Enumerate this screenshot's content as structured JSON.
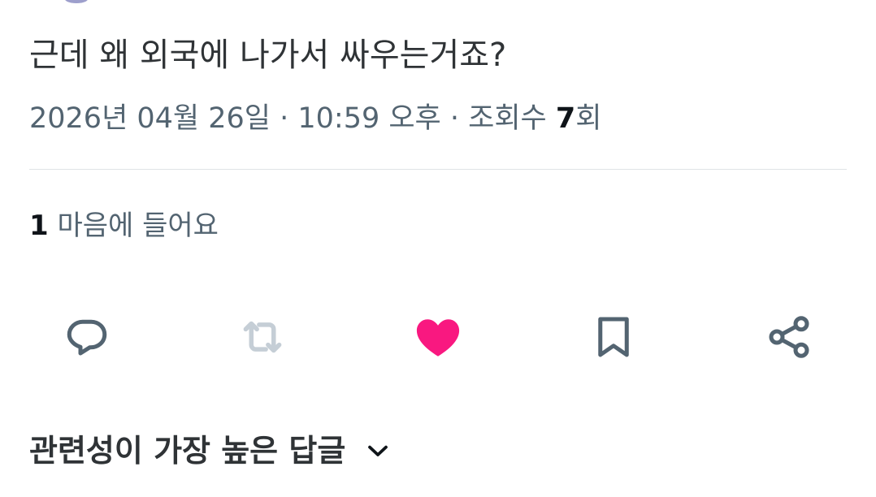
{
  "tweet": {
    "text": "근데 왜 외국에 나가서 싸우는거죠?",
    "timestamp": "2026년 04월 26일 · 10:59 오후 · 조회수 ",
    "views_count": "7",
    "views_suffix": "회"
  },
  "engagement": {
    "likes_count": "1",
    "likes_label": " 마음에 들어요"
  },
  "actions": {
    "reply_icon": "speech-bubble-icon",
    "retweet_icon": "retweet-icon",
    "like_icon": "heart-icon",
    "bookmark_icon": "bookmark-icon",
    "share_icon": "share-icon",
    "like_active_color": "#f91880",
    "icon_color": "#536471",
    "retweet_disabled_color": "#c5ced6"
  },
  "replies": {
    "sort_label": "관련성이 가장 높은 답글",
    "sort_icon": "chevron-down-icon"
  }
}
